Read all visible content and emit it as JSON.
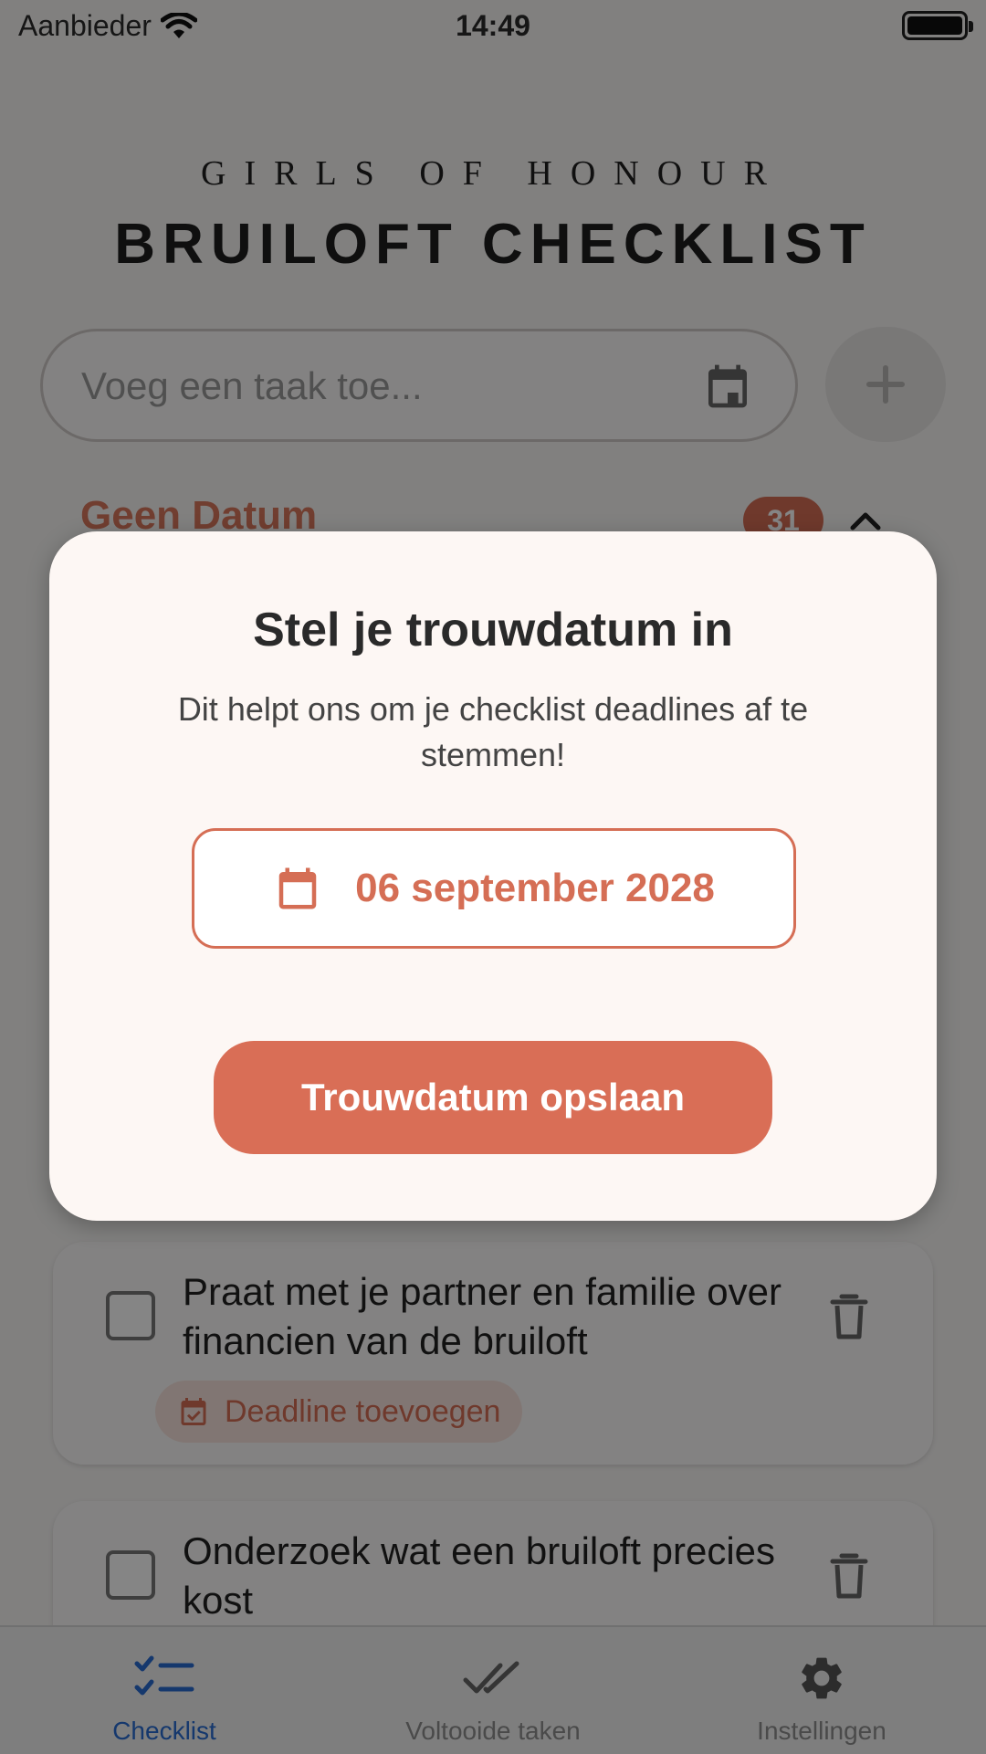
{
  "status_bar": {
    "carrier": "Aanbieder",
    "time": "14:49"
  },
  "brand": {
    "subtitle": "GIRLS OF HONOUR",
    "title": "BRUILOFT CHECKLIST"
  },
  "task_input": {
    "placeholder": "Voeg een taak toe...",
    "value": ""
  },
  "section": {
    "title": "Geen Datum",
    "count": "31",
    "collapse_icon": "chevron-up-icon"
  },
  "tasks": [
    {
      "title": "Praat met je partner en familie over financien van de bruiloft",
      "deadline_label": "Deadline toevoegen"
    },
    {
      "title": "Onderzoek wat een bruiloft precies kost"
    }
  ],
  "modal": {
    "title": "Stel je trouwdatum in",
    "subtitle": "Dit helpt ons om je checklist deadlines af te stemmen!",
    "date": "06 september 2028",
    "save_label": "Trouwdatum opslaan"
  },
  "tabs": [
    {
      "label": "Checklist",
      "icon": "checklist-icon",
      "active": true
    },
    {
      "label": "Voltooide taken",
      "icon": "double-check-icon",
      "active": false
    },
    {
      "label": "Instellingen",
      "icon": "gear-icon",
      "active": false
    }
  ],
  "colors": {
    "accent": "#d56e55",
    "tab_active": "#2a6bd2",
    "modal_bg": "#fdf7f4"
  }
}
